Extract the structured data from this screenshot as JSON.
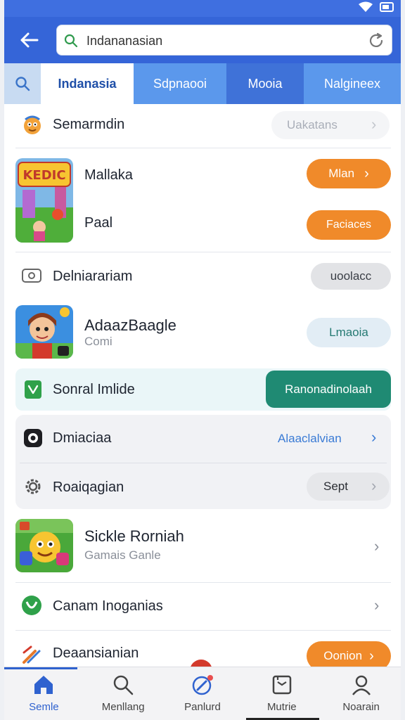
{
  "search": {
    "value": "Indananasian"
  },
  "tabs": [
    {
      "label": "Indanasia"
    },
    {
      "label": "Sdpnaooi"
    },
    {
      "label": "Mooia"
    },
    {
      "label": "Nalgineex"
    }
  ],
  "rows": {
    "row1": {
      "label": "Semarmdin",
      "action": "Uakatans"
    },
    "row2": {
      "label": "Mallaka",
      "action": "Mlan"
    },
    "row3": {
      "label": "Paal",
      "action": "Faciaces"
    },
    "row4": {
      "label": "Delniarariam",
      "action": "uoolacc"
    },
    "row5": {
      "title": "AdaazBaagle",
      "subtitle": "Comi",
      "action": "Lmaoia"
    },
    "row6": {
      "label": "Sonral Imlide",
      "action": "Ranonadinolaah"
    },
    "row7": {
      "label": "Dmiaciaa",
      "link": "Alaaclalvian"
    },
    "row8": {
      "label": "Roaiqagian",
      "action": "Sept"
    },
    "row9": {
      "title": "Sickle Rorniah",
      "subtitle": "Gamais Ganle"
    },
    "row10": {
      "label": "Canam Inoganias"
    },
    "row11": {
      "label": "Deaansianian",
      "action": "Oonion"
    }
  },
  "app_art": {
    "tile1": "KEDIC"
  },
  "nav": [
    {
      "label": "Semle",
      "icon": "home-icon"
    },
    {
      "label": "Menllang",
      "icon": "search-icon"
    },
    {
      "label": "Panlurd",
      "icon": "compass-icon"
    },
    {
      "label": "Mutrie",
      "icon": "inbox-icon"
    },
    {
      "label": "Noarain",
      "icon": "profile-icon"
    }
  ],
  "colors": {
    "header": "#3565d8",
    "accent_orange": "#f08a2a",
    "accent_teal": "#1f8a73",
    "link_blue": "#3a7bd5"
  }
}
